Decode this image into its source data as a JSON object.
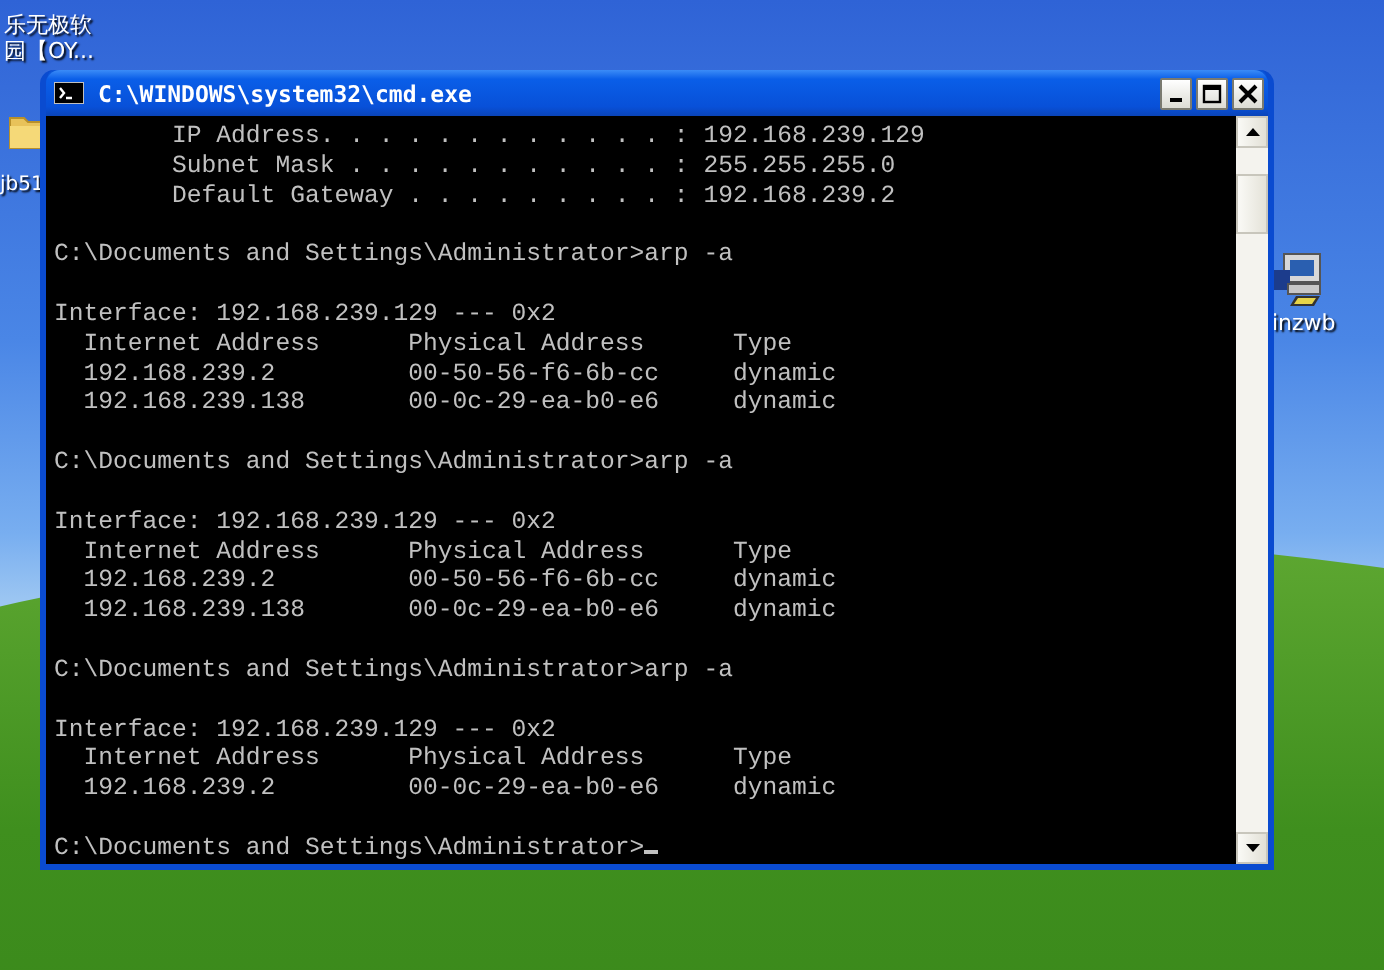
{
  "desktop_icons": [
    {
      "kind": "label-only",
      "label_lines": [
        "乐无极软",
        "园【OY..."
      ]
    },
    {
      "kind": "folder",
      "label_lines": [
        "jb51"
      ]
    },
    {
      "kind": "computer",
      "label_lines": [
        "inzwb"
      ]
    }
  ],
  "window": {
    "title": "C:\\WINDOWS\\system32\\cmd.exe"
  },
  "console": {
    "cursor": true,
    "blocks": [
      [
        "        IP Address. . . . . . . . . . . . : 192.168.239.129",
        "        Subnet Mask . . . . . . . . . . . : 255.255.255.0",
        "        Default Gateway . . . . . . . . . : 192.168.239.2"
      ],
      [
        "C:\\Documents and Settings\\Administrator>arp -a"
      ],
      [
        "Interface: 192.168.239.129 --- 0x2",
        "  Internet Address      Physical Address      Type",
        "  192.168.239.2         00-50-56-f6-6b-cc     dynamic",
        "  192.168.239.138       00-0c-29-ea-b0-e6     dynamic"
      ],
      [
        "C:\\Documents and Settings\\Administrator>arp -a"
      ],
      [
        "Interface: 192.168.239.129 --- 0x2",
        "  Internet Address      Physical Address      Type",
        "  192.168.239.2         00-50-56-f6-6b-cc     dynamic",
        "  192.168.239.138       00-0c-29-ea-b0-e6     dynamic"
      ],
      [
        "C:\\Documents and Settings\\Administrator>arp -a"
      ],
      [
        "Interface: 192.168.239.129 --- 0x2",
        "  Internet Address      Physical Address      Type",
        "  192.168.239.2         00-0c-29-ea-b0-e6     dynamic"
      ],
      [
        "C:\\Documents and Settings\\Administrator>"
      ]
    ]
  }
}
